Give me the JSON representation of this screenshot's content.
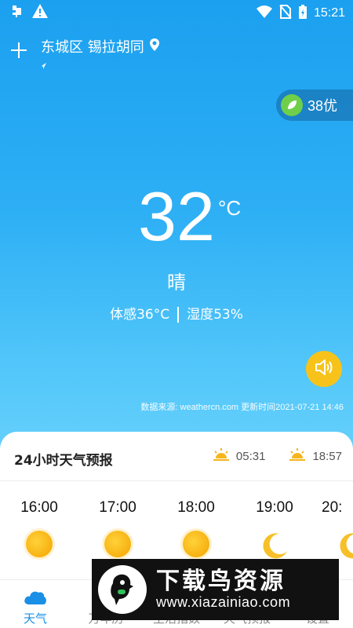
{
  "status_bar": {
    "time": "15:21",
    "icons": [
      "bug-icon",
      "warning-icon",
      "wifi-icon",
      "no-sim-icon",
      "battery-charging-icon"
    ]
  },
  "header": {
    "location": "东城区 锡拉胡同"
  },
  "aqi": {
    "label": "38优",
    "color": "#6fcf4a"
  },
  "current": {
    "temperature": "32",
    "unit": "°C",
    "condition": "晴",
    "feels_like": "体感36°C",
    "humidity": "湿度53%"
  },
  "source": {
    "text": "数据来源: weathercn.com 更新时间2021-07-21 14:46"
  },
  "hourly": {
    "title": "24小时天气预报",
    "sunrise": "05:31",
    "sunset": "18:57",
    "hours": [
      {
        "time": "16:00",
        "icon": "sun-icon"
      },
      {
        "time": "17:00",
        "icon": "sun-icon"
      },
      {
        "time": "18:00",
        "icon": "sun-icon"
      },
      {
        "time": "19:00",
        "icon": "moon-icon"
      },
      {
        "time": "20:",
        "icon": "moon-icon"
      }
    ]
  },
  "tabs": [
    {
      "label": "天气",
      "active": true
    },
    {
      "label": "万年历",
      "active": false
    },
    {
      "label": "生活指数",
      "active": false
    },
    {
      "label": "天气预报",
      "active": false
    },
    {
      "label": "设置",
      "active": false
    }
  ],
  "watermark": {
    "title": "下载鸟资源",
    "url": "www.xiazainiao.com"
  },
  "colors": {
    "accent": "#1a8fe6",
    "speaker": "#f7c31a",
    "sun": "#f4a300"
  }
}
